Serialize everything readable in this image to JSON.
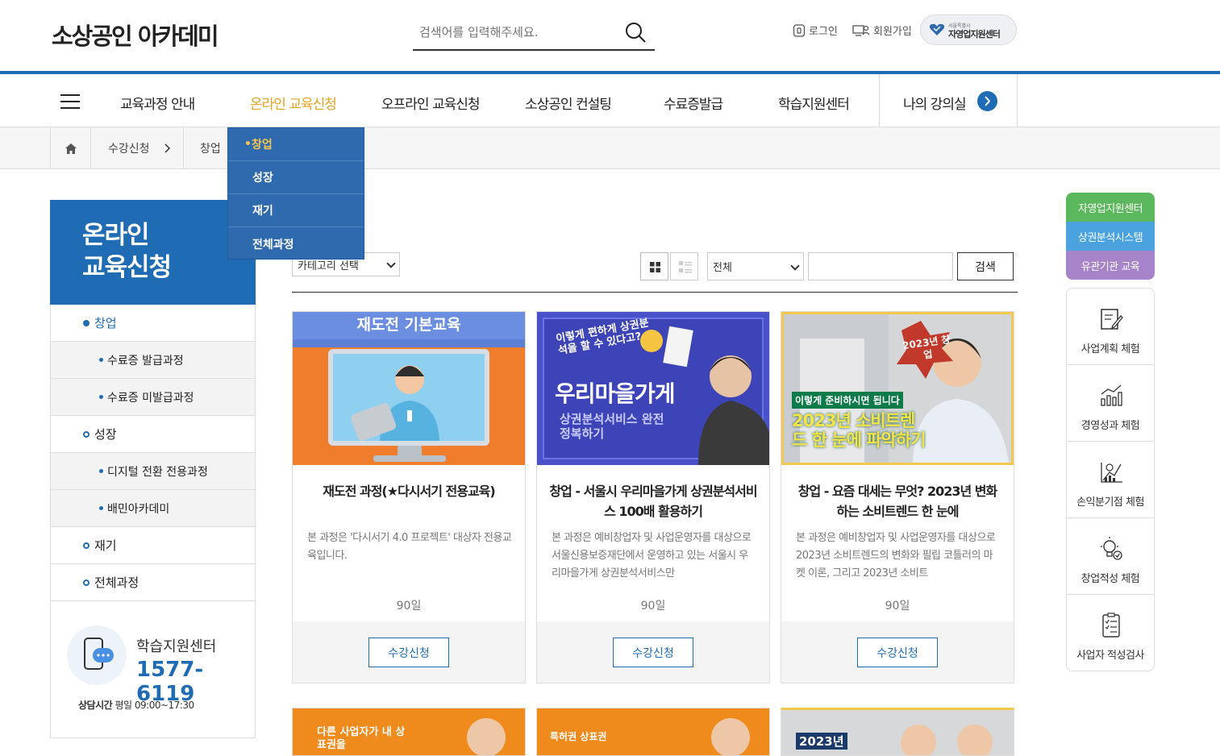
{
  "header": {
    "logo": "소상공인 아카데미",
    "search_placeholder": "검색어를 입력해주세요.",
    "login": "로그인",
    "signup": "회원가입",
    "center_small": "서울특별시",
    "center_name": "자영업지원센터"
  },
  "gnb": {
    "items": [
      "교육과정 안내",
      "온라인 교육신청",
      "오프라인 교육신청",
      "소상공인 컨설팅",
      "수료증발급",
      "학습지원센터",
      "나의 강의실"
    ]
  },
  "breadcrumb": {
    "level1": "수강신청",
    "level2": "창업"
  },
  "dropdown": {
    "items": [
      "창업",
      "성장",
      "재기",
      "전체과정"
    ]
  },
  "lnb": {
    "title_line1": "온라인",
    "title_line2": "교육신청",
    "items": [
      {
        "label": "창업"
      },
      {
        "label": "수료증 발급과정"
      },
      {
        "label": "수료증 미발급과정"
      },
      {
        "label": "성장"
      },
      {
        "label": "디지털 전환 전용과정"
      },
      {
        "label": "배민아카데미"
      },
      {
        "label": "재기"
      },
      {
        "label": "전체과정"
      }
    ],
    "support_title": "학습지원센터",
    "support_phone": "1577-6119",
    "support_hours_label": "상담시간",
    "support_hours": "평일 09:00~17:30"
  },
  "toolbar": {
    "category_select": "카테고리 선택",
    "filter_select": "전체",
    "search_button": "검색"
  },
  "cards": [
    {
      "thumb_text": "재도전 기본교육",
      "title": "재도전 과정(★다시서기 전용교육)",
      "desc": "본 과정은 '다시서기 4.0 프로젝트' 대상자 전용교육입니다.",
      "days": "90일",
      "button": "수강신청"
    },
    {
      "thumb_text1": "이렇게 편하게 상권분석을 할 수 있다고?",
      "thumb_text2": "우리마을가게",
      "thumb_text3": "상권분석서비스 완전정복하기",
      "title": "창업 - 서울시 우리마을가게 상권분석서비스 100배 활용하기",
      "desc": "본 과정은 예비창업자 및 사업운영자를 대상으로 서울신용보증재단에서 운영하고 있는 서울시 우리마을가게 상권분석서비스만",
      "days": "90일",
      "button": "수강신청"
    },
    {
      "thumb_text1": "2023년 창업",
      "thumb_text2": "이렇게 준비하시면 됩니다",
      "thumb_text3": "2023년 소비트렌드 한 눈에 파악하기",
      "title": "창업 - 요즘 대세는 무엇? 2023년 변화하는 소비트렌드 한 눈에",
      "desc": "본 과정은 예비창업자 및 사업운영자를 대상으로 2023년 소비트렌드의 변화와 필립 코틀러의 마켓 이론, 그리고 2023년 소비트",
      "days": "90일",
      "button": "수강신청"
    }
  ],
  "cards_row2": [
    {
      "thumb_text": "다른 사업자가 내 상표권을"
    },
    {
      "thumb_text": "특허권 상표권"
    },
    {
      "thumb_text": "2023년"
    }
  ],
  "quick": {
    "links": [
      {
        "label": "자영업지원센터",
        "color": "#5cb85c"
      },
      {
        "label": "상권분석시스템",
        "color": "#4aa3df"
      },
      {
        "label": "유관기관 교육",
        "color": "#a783c9"
      }
    ],
    "items": [
      {
        "label": "사업계획 체험",
        "icon": "document-pen-icon"
      },
      {
        "label": "경영성과 체험",
        "icon": "growth-chart-icon"
      },
      {
        "label": "손익분기점 체험",
        "icon": "breakeven-chart-icon"
      },
      {
        "label": "창업적성 체험",
        "icon": "lightbulb-check-icon"
      },
      {
        "label": "사업자 적성검사",
        "icon": "checklist-icon"
      }
    ]
  }
}
